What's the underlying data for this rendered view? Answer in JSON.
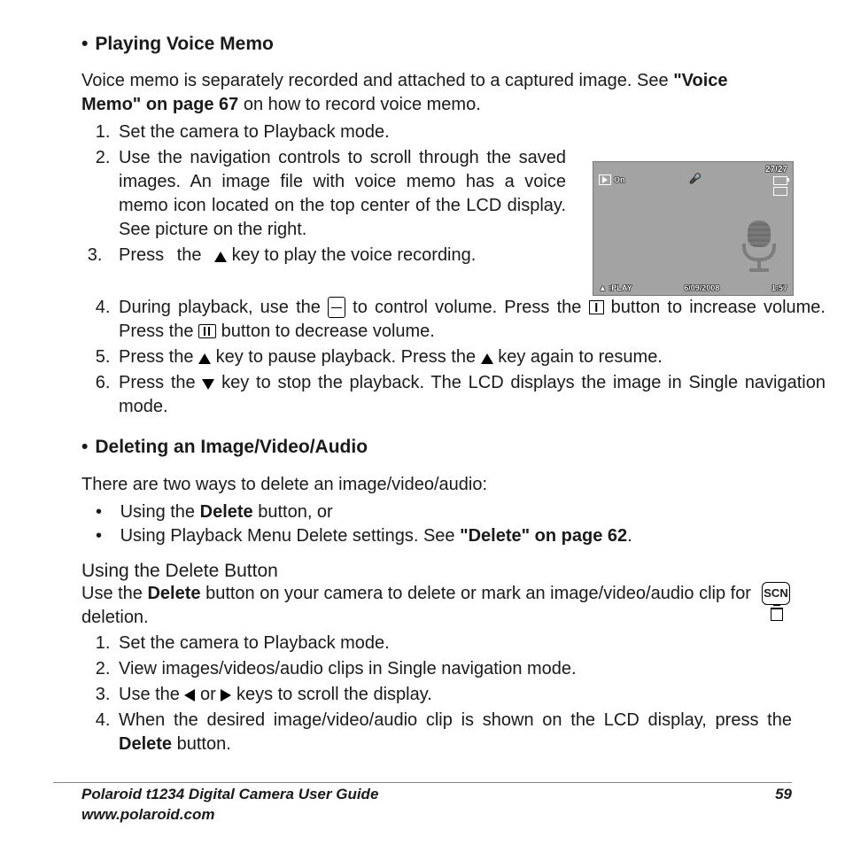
{
  "section1_heading": "Playing Voice Memo",
  "intro1a": "Voice memo is separately recorded and attached to a captured image. See ",
  "intro1_boldlink": "\"Voice Memo\" on page 67",
  "intro1b": " on how to record voice memo.",
  "steps1": {
    "s1": "Set the camera to Playback mode.",
    "s2": "Use the navigation controls to scroll through the saved images. An image file with voice memo has a voice memo icon located on the top center of the LCD display. See picture on the right.",
    "s3_a": "Press  the  ",
    "s3_b": "  key  to  play  the  voice recording.",
    "s4_a": "During playback, use the ",
    "s4_b": " to control volume. Press the ",
    "s4_c": " button to increase volume. Press the ",
    "s4_d": " button to decrease volume.",
    "s5_a": "Press the ",
    "s5_b": " key to pause playback. Press the ",
    "s5_c": " key again to resume.",
    "s6_a": "Press the ",
    "s6_b": " key to stop the playback. The LCD displays the image in Single navigation mode."
  },
  "lcd": {
    "key_suffix": "On",
    "counter": "27/27",
    "play_label": ":PLAY",
    "date": "6/09/2008",
    "time": "1:57"
  },
  "section2_heading": "Deleting an Image/Video/Audio",
  "intro2": "There are two ways to delete an image/video/audio:",
  "bullets2": {
    "b1_a": "Using the ",
    "b1_bold": "Delete",
    "b1_b": " button, or",
    "b2_a": "Using Playback Menu Delete settings. See ",
    "b2_bold": "\"Delete\" on page 62",
    "b2_b": "."
  },
  "sub_title": "Using the Delete Button",
  "scn_label": "SCN",
  "sub_intro_a": "Use the ",
  "sub_intro_bold": "Delete",
  "sub_intro_b": " button on your camera to delete or mark an image/video/audio clip for deletion.",
  "steps2": {
    "s1": "Set the camera to Playback mode.",
    "s2": "View images/videos/audio clips in Single navigation mode.",
    "s3_a": "Use the ",
    "s3_b": " or ",
    "s3_c": " keys to scroll the display.",
    "s4_a": "When the desired image/video/audio clip is shown on the LCD display, press the ",
    "s4_bold": "Delete",
    "s4_b": " button."
  },
  "footer": {
    "guide": "Polaroid t1234 Digital Camera User Guide",
    "site": "www.polaroid.com",
    "page": "59"
  }
}
